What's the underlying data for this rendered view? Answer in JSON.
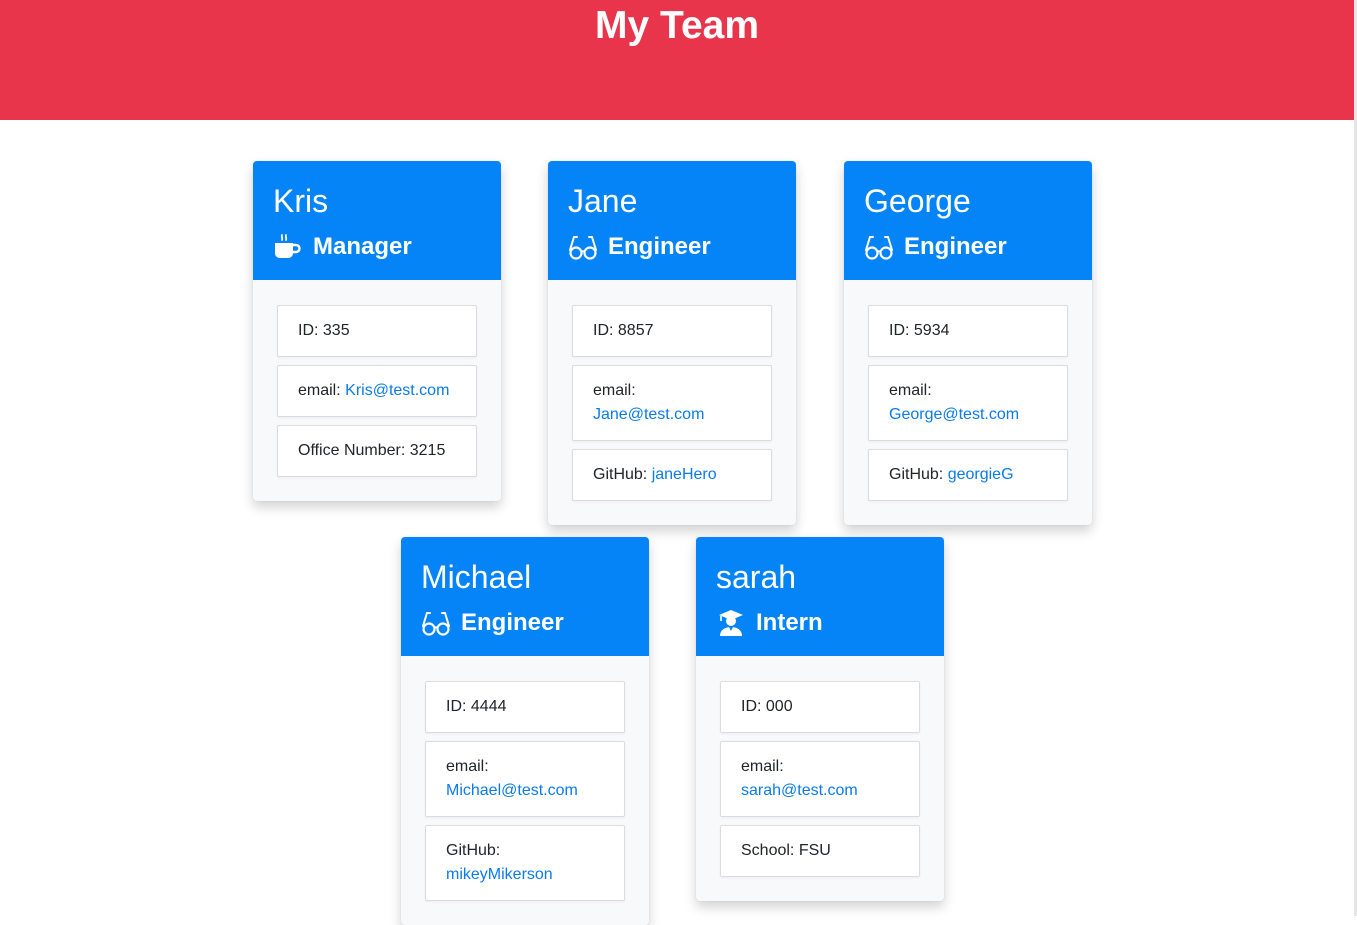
{
  "header": {
    "title": "My Team"
  },
  "colors": {
    "banner": "#e8354b",
    "card_header": "#0584f7",
    "link": "#0a7bea"
  },
  "members": [
    {
      "name": "Kris",
      "role": "Manager",
      "icon": "coffee-mug-icon",
      "id_label": "ID:",
      "id": "335",
      "email_label": "email:",
      "email": "Kris@test.com",
      "extra_label": "Office Number:",
      "extra": "3215"
    },
    {
      "name": "Jane",
      "role": "Engineer",
      "icon": "glasses-icon",
      "id_label": "ID:",
      "id": "8857",
      "email_label": "email:",
      "email": "Jane@test.com",
      "extra_label": "GitHub:",
      "extra": "janeHero"
    },
    {
      "name": "George",
      "role": "Engineer",
      "icon": "glasses-icon",
      "id_label": "ID:",
      "id": "5934",
      "email_label": "email:",
      "email": "George@test.com",
      "extra_label": "GitHub:",
      "extra": "georgieG"
    },
    {
      "name": "Michael",
      "role": "Engineer",
      "icon": "glasses-icon",
      "id_label": "ID:",
      "id": "4444",
      "email_label": "email:",
      "email": "Michael@test.com",
      "extra_label": "GitHub:",
      "extra": "mikeyMikerson"
    },
    {
      "name": "sarah",
      "role": "Intern",
      "icon": "graduate-icon",
      "id_label": "ID:",
      "id": "000",
      "email_label": "email:",
      "email": "sarah@test.com",
      "extra_label": "School:",
      "extra": "FSU"
    }
  ]
}
